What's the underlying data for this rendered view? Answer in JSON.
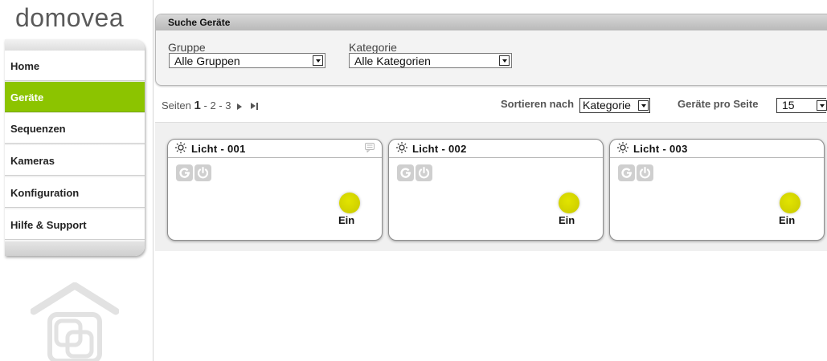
{
  "brand": {
    "name": "domovea"
  },
  "sidebar": {
    "items": [
      {
        "label": "Home"
      },
      {
        "label": "Geräte",
        "active": true
      },
      {
        "label": "Sequenzen"
      },
      {
        "label": "Kameras"
      },
      {
        "label": "Konfiguration"
      },
      {
        "label": "Hilfe & Support"
      }
    ]
  },
  "search": {
    "title": "Suche Geräte",
    "group_label": "Gruppe",
    "group_value": "Alle Gruppen",
    "category_label": "Kategorie",
    "category_value": "Alle Kategorien"
  },
  "pager": {
    "label": "Seiten",
    "current": "1",
    "sep1": "-",
    "page2": "2",
    "sep2": "-",
    "page3": "3"
  },
  "sorting": {
    "sort_label": "Sortieren nach",
    "sort_value": "Kategorie",
    "per_page_label": "Geräte pro Seite",
    "per_page_value": "15"
  },
  "devices": [
    {
      "name": "Licht - 001",
      "state": "Ein"
    },
    {
      "name": "Licht - 002",
      "state": "Ein"
    },
    {
      "name": "Licht - 003",
      "state": "Ein"
    }
  ],
  "colors": {
    "accent_green": "#8cc400",
    "lamp_on": "#d4d600"
  }
}
